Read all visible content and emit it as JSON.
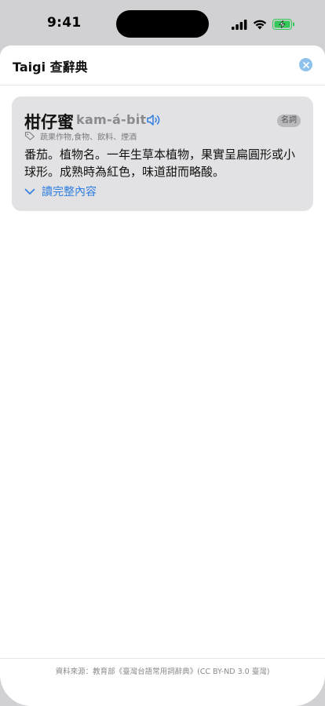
{
  "status_bar": {
    "time": "9:41",
    "icons": [
      "cellular-signal-icon",
      "wifi-icon",
      "battery-charging-icon"
    ],
    "battery_color": "#34c759"
  },
  "sheet": {
    "title": "Taigi 查辭典",
    "close_icon": "close-icon",
    "accent_color": "#2f7ee0"
  },
  "entry": {
    "word": "柑仔蜜",
    "romanization": "kam-á-bi̍t",
    "part_of_speech": "名詞",
    "tags": "蔬果作物,食物、飲料、煙酒",
    "definition": "番茄。植物名。一年生草本植物，果實呈扁圓形或小球形。成熟時為紅色，味道甜而略酸。",
    "read_more_label": "讀完整內容"
  },
  "footer": {
    "source": "資料來源：教育部《臺灣台語常用詞辭典》(CC BY-ND 3.0 臺灣)"
  }
}
